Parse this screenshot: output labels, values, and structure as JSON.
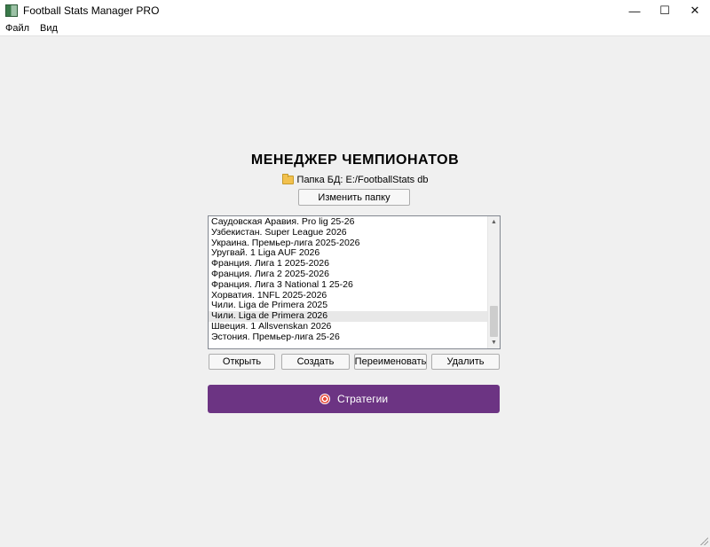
{
  "window": {
    "title": "Football Stats Manager PRO",
    "minimize": "—",
    "maximize": "☐",
    "close": "✕"
  },
  "menu": {
    "file": "Файл",
    "view": "Вид"
  },
  "main": {
    "heading": "МЕНЕДЖЕР ЧЕМПИОНАТОВ",
    "db_path": "Папка БД: E:/FootballStats db",
    "change_folder": "Изменить папку",
    "championships": [
      "Саудовская Аравия. Pro lig 25-26",
      "Узбекистан. Super League 2026",
      "Украина. Премьер-лига 2025-2026",
      "Уругвай. 1 Liga AUF 2026",
      "Франция. Лига 1 2025-2026",
      "Франция. Лига 2 2025-2026",
      "Франция. Лига 3 National 1 25-26",
      "Хорватия. 1NFL 2025-2026",
      "Чили. Liga de Primera 2025",
      "Чили. Liga de Primera 2026",
      "Швеция. 1 Allsvenskan 2026",
      "Эстония. Премьер-лига 25-26"
    ],
    "selected_index": 9,
    "actions": {
      "open": "Открыть",
      "create": "Создать",
      "rename": "Переименовать",
      "delete": "Удалить"
    },
    "strategies": "Стратегии"
  },
  "colors": {
    "accent": "#6c3483"
  }
}
